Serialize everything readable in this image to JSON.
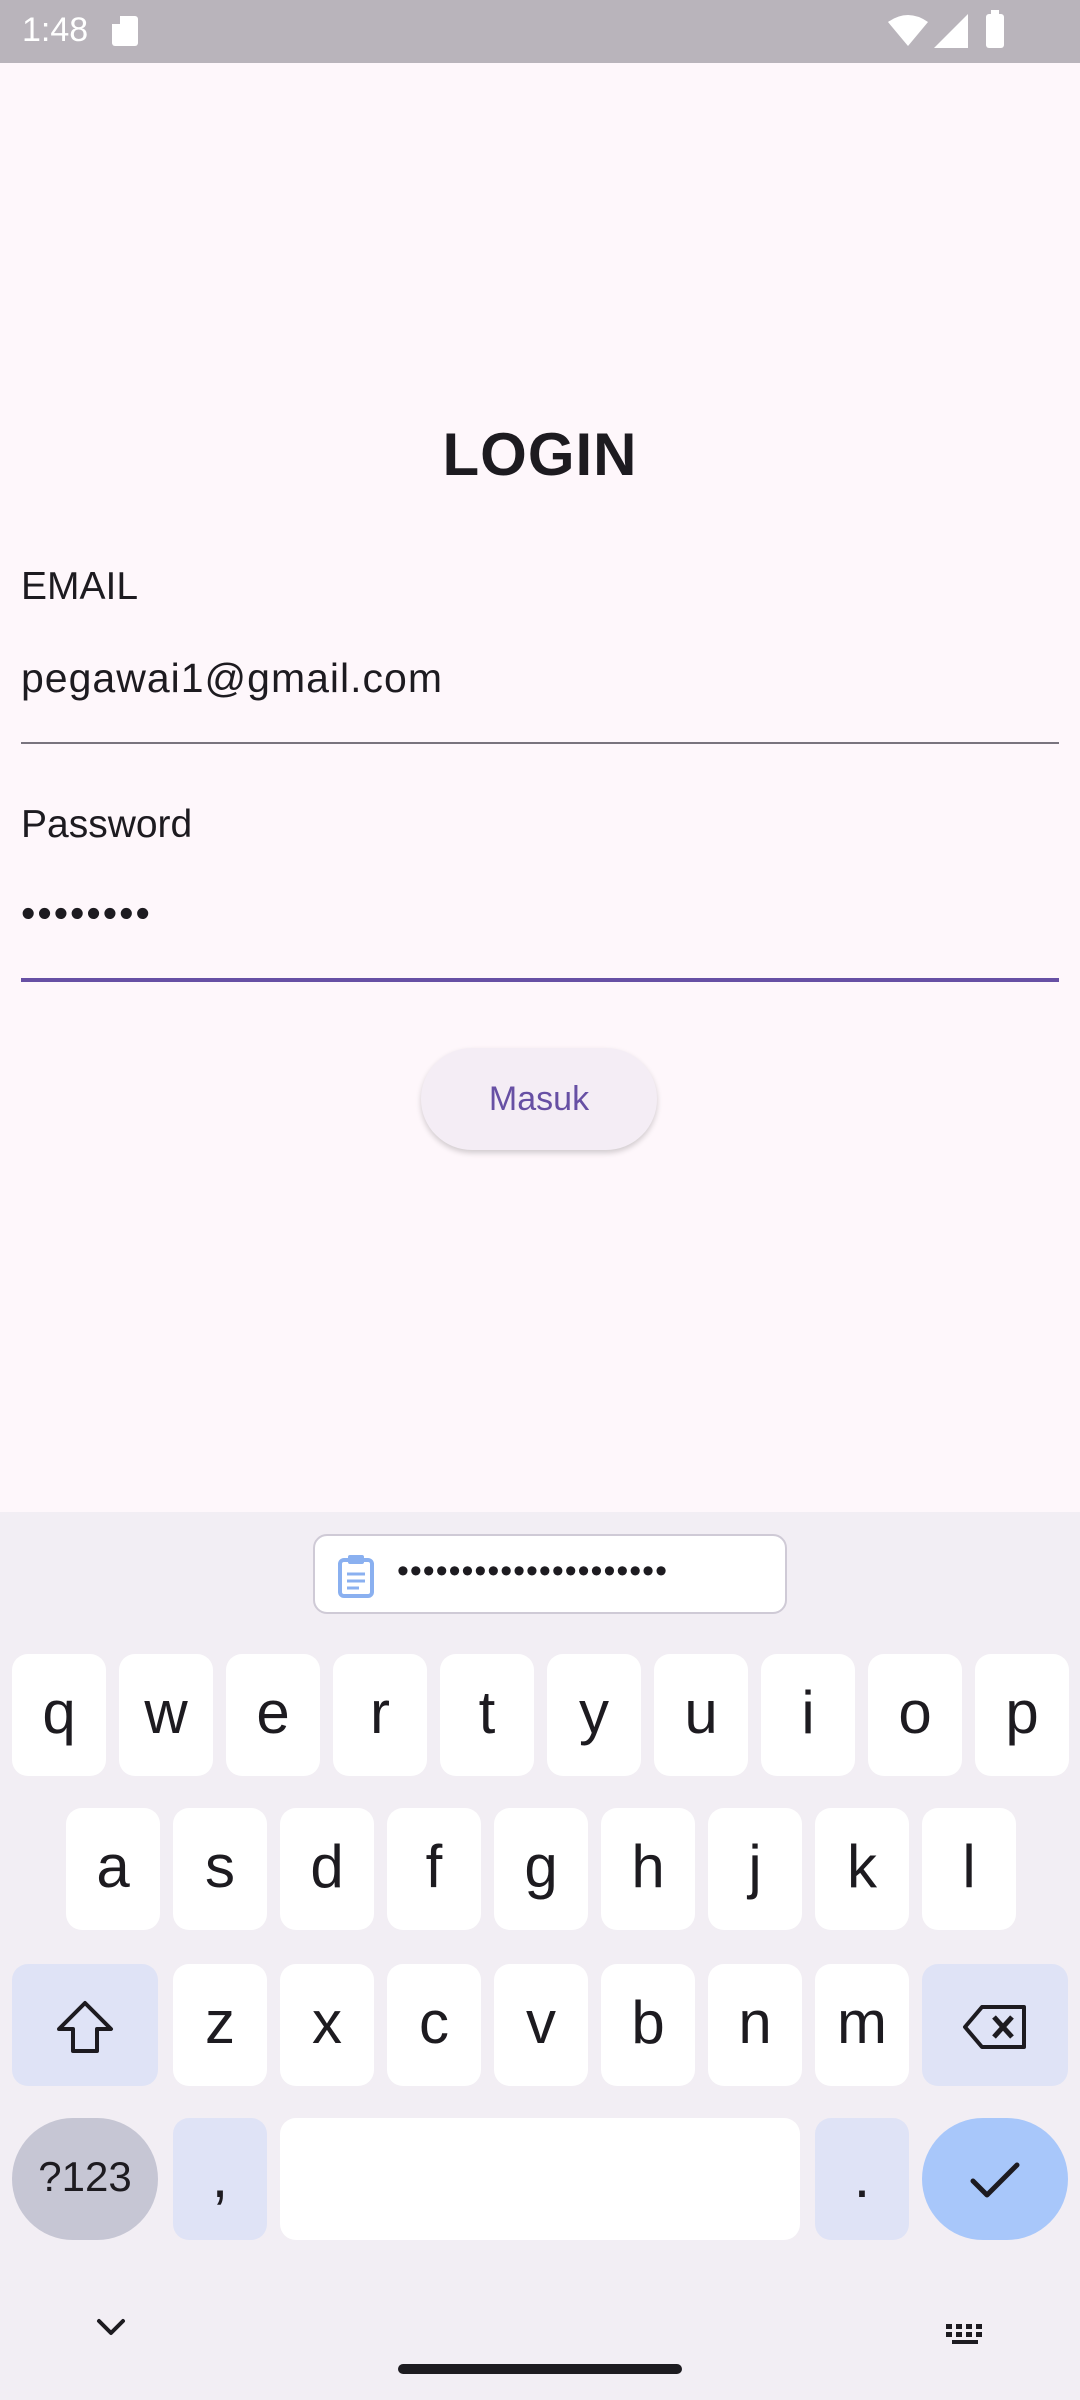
{
  "status_bar": {
    "time": "1:48"
  },
  "login": {
    "title": "LOGIN",
    "email_label": "EMAIL",
    "email_value": "pegawai1@gmail.com",
    "password_label": "Password",
    "password_value": "••••••••",
    "submit_label": "Masuk"
  },
  "keyboard": {
    "clipboard_text": "•••••••••••••••••••••",
    "row1": [
      "q",
      "w",
      "e",
      "r",
      "t",
      "y",
      "u",
      "i",
      "o",
      "p"
    ],
    "row2": [
      "a",
      "s",
      "d",
      "f",
      "g",
      "h",
      "j",
      "k",
      "l"
    ],
    "row3": [
      "z",
      "x",
      "c",
      "v",
      "b",
      "n",
      "m"
    ],
    "symbols_label": "?123",
    "comma_label": ",",
    "period_label": "."
  },
  "colors": {
    "accent": "#6750a4",
    "background": "#fef7fb",
    "keyboard_bg": "#f2eef4",
    "enter_key": "#a8c7fa"
  }
}
